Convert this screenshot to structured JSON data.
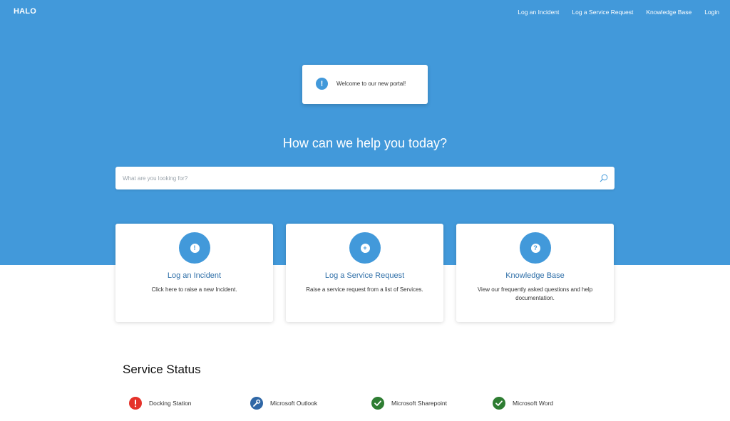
{
  "header": {
    "logo": "HALO",
    "nav": [
      {
        "label": "Log an Incident"
      },
      {
        "label": "Log a Service Request"
      },
      {
        "label": "Knowledge Base"
      },
      {
        "label": "Login"
      }
    ]
  },
  "notice": {
    "text": "Welcome to our new portal!",
    "icon": "exclamation-icon"
  },
  "hero": {
    "title": "How can we help you today?"
  },
  "search": {
    "placeholder": "What are you looking for?",
    "value": "",
    "icon": "search-icon"
  },
  "cards": [
    {
      "title": "Log an Incident",
      "description": "Click here to raise a new Incident.",
      "icon": "exclamation-icon",
      "glyph": "!"
    },
    {
      "title": "Log a Service Request",
      "description": "Raise a service request from a list of Services.",
      "icon": "plus-icon",
      "glyph": "+"
    },
    {
      "title": "Knowledge Base",
      "description": "View our frequently asked questions and help documentation.",
      "icon": "question-icon",
      "glyph": "?"
    }
  ],
  "service_status": {
    "title": "Service Status",
    "items": [
      {
        "label": "Docking Station",
        "status": "down",
        "icon": "exclamation-icon",
        "color": "#e5322a"
      },
      {
        "label": "Microsoft Outlook",
        "status": "maintenance",
        "icon": "wrench-icon",
        "color": "#2f67a6"
      },
      {
        "label": "Microsoft Sharepoint",
        "status": "ok",
        "icon": "check-icon",
        "color": "#2e7d32"
      },
      {
        "label": "Microsoft Word",
        "status": "ok",
        "icon": "check-icon",
        "color": "#2e7d32"
      }
    ]
  },
  "colors": {
    "brand": "#4299da",
    "link": "#2f6fa8"
  }
}
